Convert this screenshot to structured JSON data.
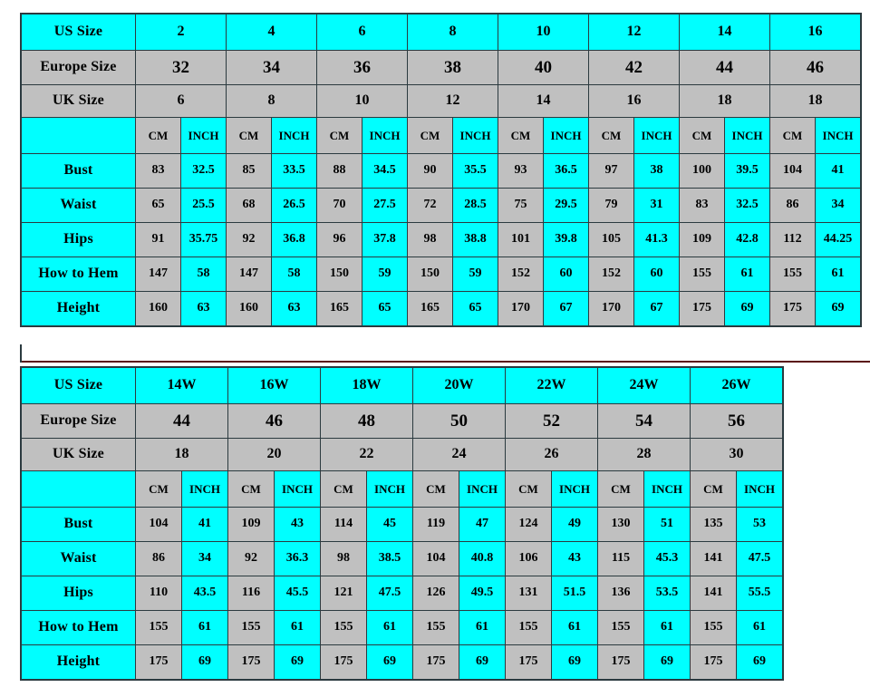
{
  "tables": [
    {
      "id": "standard-sizes",
      "row_labels": {
        "us": "US Size",
        "europe": "Europe Size",
        "uk": "UK Size",
        "unit": "",
        "bust": "Bust",
        "waist": "Waist",
        "hips": "Hips",
        "hem": "How to Hem",
        "height": "Height"
      },
      "unit_headers": {
        "cm": "CM",
        "inch": "INCH"
      },
      "columns": [
        {
          "us": "2",
          "europe": "32",
          "uk": "6",
          "bust_cm": "83",
          "bust_in": "32.5",
          "waist_cm": "65",
          "waist_in": "25.5",
          "hips_cm": "91",
          "hips_in": "35.75",
          "hem_cm": "147",
          "hem_in": "58",
          "height_cm": "160",
          "height_in": "63",
          "muted": true
        },
        {
          "us": "4",
          "europe": "34",
          "uk": "8",
          "bust_cm": "85",
          "bust_in": "33.5",
          "waist_cm": "68",
          "waist_in": "26.5",
          "hips_cm": "92",
          "hips_in": "36.8",
          "hem_cm": "147",
          "hem_in": "58",
          "height_cm": "160",
          "height_in": "63",
          "muted": false
        },
        {
          "us": "6",
          "europe": "36",
          "uk": "10",
          "bust_cm": "88",
          "bust_in": "34.5",
          "waist_cm": "70",
          "waist_in": "27.5",
          "hips_cm": "96",
          "hips_in": "37.8",
          "hem_cm": "150",
          "hem_in": "59",
          "height_cm": "165",
          "height_in": "65",
          "muted": false
        },
        {
          "us": "8",
          "europe": "38",
          "uk": "12",
          "bust_cm": "90",
          "bust_in": "35.5",
          "waist_cm": "72",
          "waist_in": "28.5",
          "hips_cm": "98",
          "hips_in": "38.8",
          "hem_cm": "150",
          "hem_in": "59",
          "height_cm": "165",
          "height_in": "65",
          "muted": false
        },
        {
          "us": "10",
          "europe": "40",
          "uk": "14",
          "bust_cm": "93",
          "bust_in": "36.5",
          "waist_cm": "75",
          "waist_in": "29.5",
          "hips_cm": "101",
          "hips_in": "39.8",
          "hem_cm": "152",
          "hem_in": "60",
          "height_cm": "170",
          "height_in": "67",
          "muted": false
        },
        {
          "us": "12",
          "europe": "42",
          "uk": "16",
          "bust_cm": "97",
          "bust_in": "38",
          "waist_cm": "79",
          "waist_in": "31",
          "hips_cm": "105",
          "hips_in": "41.3",
          "hem_cm": "152",
          "hem_in": "60",
          "height_cm": "170",
          "height_in": "67",
          "muted": false
        },
        {
          "us": "14",
          "europe": "44",
          "uk": "18",
          "bust_cm": "100",
          "bust_in": "39.5",
          "waist_cm": "83",
          "waist_in": "32.5",
          "hips_cm": "109",
          "hips_in": "42.8",
          "hem_cm": "155",
          "hem_in": "61",
          "height_cm": "175",
          "height_in": "69",
          "muted": false
        },
        {
          "us": "16",
          "europe": "46",
          "uk": "18",
          "bust_cm": "104",
          "bust_in": "41",
          "waist_cm": "86",
          "waist_in": "34",
          "hips_cm": "112",
          "hips_in": "44.25",
          "hem_cm": "155",
          "hem_in": "61",
          "height_cm": "175",
          "height_in": "69",
          "muted": false
        }
      ]
    },
    {
      "id": "plus-sizes",
      "row_labels": {
        "us": "US Size",
        "europe": "Europe Size",
        "uk": "UK Size",
        "unit": "",
        "bust": "Bust",
        "waist": "Waist",
        "hips": "Hips",
        "hem": "How to Hem",
        "height": "Height"
      },
      "unit_headers": {
        "cm": "CM",
        "inch": "INCH"
      },
      "columns": [
        {
          "us": "14W",
          "europe": "44",
          "uk": "18",
          "bust_cm": "104",
          "bust_in": "41",
          "waist_cm": "86",
          "waist_in": "34",
          "hips_cm": "110",
          "hips_in": "43.5",
          "hem_cm": "155",
          "hem_in": "61",
          "height_cm": "175",
          "height_in": "69",
          "muted": false
        },
        {
          "us": "16W",
          "europe": "46",
          "uk": "20",
          "bust_cm": "109",
          "bust_in": "43",
          "waist_cm": "92",
          "waist_in": "36.3",
          "hips_cm": "116",
          "hips_in": "45.5",
          "hem_cm": "155",
          "hem_in": "61",
          "height_cm": "175",
          "height_in": "69",
          "muted": false
        },
        {
          "us": "18W",
          "europe": "48",
          "uk": "22",
          "bust_cm": "114",
          "bust_in": "45",
          "waist_cm": "98",
          "waist_in": "38.5",
          "hips_cm": "121",
          "hips_in": "47.5",
          "hem_cm": "155",
          "hem_in": "61",
          "height_cm": "175",
          "height_in": "69",
          "muted": false
        },
        {
          "us": "20W",
          "europe": "50",
          "uk": "24",
          "bust_cm": "119",
          "bust_in": "47",
          "waist_cm": "104",
          "waist_in": "40.8",
          "hips_cm": "126",
          "hips_in": "49.5",
          "hem_cm": "155",
          "hem_in": "61",
          "height_cm": "175",
          "height_in": "69",
          "muted": false
        },
        {
          "us": "22W",
          "europe": "52",
          "uk": "26",
          "bust_cm": "124",
          "bust_in": "49",
          "waist_cm": "106",
          "waist_in": "43",
          "hips_cm": "131",
          "hips_in": "51.5",
          "hem_cm": "155",
          "hem_in": "61",
          "height_cm": "175",
          "height_in": "69",
          "muted": false
        },
        {
          "us": "24W",
          "europe": "54",
          "uk": "28",
          "bust_cm": "130",
          "bust_in": "51",
          "waist_cm": "115",
          "waist_in": "45.3",
          "hips_cm": "136",
          "hips_in": "53.5",
          "hem_cm": "155",
          "hem_in": "61",
          "height_cm": "175",
          "height_in": "69",
          "muted": false
        },
        {
          "us": "26W",
          "europe": "56",
          "uk": "30",
          "bust_cm": "135",
          "bust_in": "53",
          "waist_cm": "141",
          "waist_in": "47.5",
          "hips_cm": "141",
          "hips_in": "55.5",
          "hem_cm": "155",
          "hem_in": "61",
          "height_cm": "175",
          "height_in": "69",
          "muted": false
        }
      ]
    }
  ],
  "colors": {
    "accent_cyan": "#00ffff",
    "panel_gray": "#c0c0c0",
    "border": "#2b3a3f",
    "muted_text": "#3f5560",
    "divider_rule": "#5a1414"
  }
}
